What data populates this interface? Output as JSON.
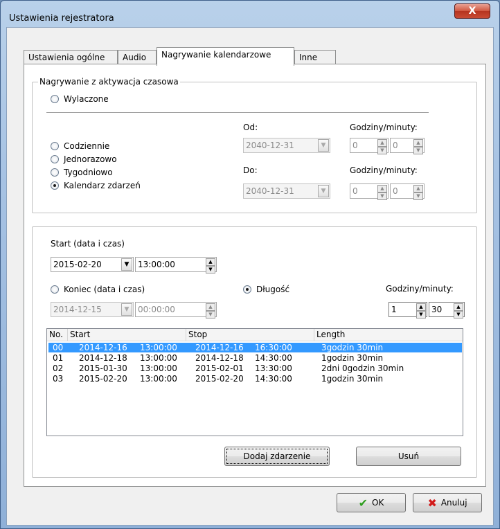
{
  "window": {
    "title": "Ustawienia rejestratora",
    "close_glyph": "X"
  },
  "tabs": [
    {
      "label": "Ustawienia ogólne"
    },
    {
      "label": "Audio"
    },
    {
      "label": "Nagrywanie kalendarzowe"
    },
    {
      "label": "Inne"
    }
  ],
  "timed_group": {
    "title": "Nagrywanie z aktywacja czasowa",
    "off_radio": "Wylaczone",
    "mode_radios": [
      "Codziennie",
      "Jednorazowo",
      "Tygodniowo",
      "Kalendarz zdarzeń"
    ],
    "selected_mode": "Kalendarz zdarzeń",
    "from_label": "Od:",
    "to_label": "Do:",
    "from_date": "2040-12-31",
    "to_date": "2040-12-31",
    "hours_minutes_label": "Godziny/minuty:",
    "from_hours": "0",
    "from_minutes": "0",
    "to_hours": "0",
    "to_minutes": "0"
  },
  "event_group": {
    "start_label": "Start (data i czas)",
    "start_date": "2015-02-20",
    "start_time": "13:00:00",
    "end_label": "Koniec (data i czas)",
    "end_date": "2014-12-15",
    "end_time": "00:00:00",
    "length_label": "Długość",
    "length_selected": true,
    "hours_minutes_label": "Godziny/minuty:",
    "length_hours": "1",
    "length_minutes": "30"
  },
  "events_table": {
    "columns": [
      "No.",
      "Start",
      "Stop",
      "Length"
    ],
    "rows": [
      {
        "no": "00",
        "start_date": "2014-12-16",
        "start_time": "13:00:00",
        "stop_date": "2014-12-16",
        "stop_time": "16:30:00",
        "length": "3godzin 30min",
        "selected": true
      },
      {
        "no": "01",
        "start_date": "2014-12-18",
        "start_time": "13:00:00",
        "stop_date": "2014-12-18",
        "stop_time": "14:30:00",
        "length": "1godzin 30min",
        "selected": false
      },
      {
        "no": "02",
        "start_date": "2015-01-30",
        "start_time": "13:00:00",
        "stop_date": "2015-02-01",
        "stop_time": "13:30:00",
        "length": "2dni 0godzin 30min",
        "selected": false
      },
      {
        "no": "03",
        "start_date": "2015-02-20",
        "start_time": "13:00:00",
        "stop_date": "2015-02-20",
        "stop_time": "14:30:00",
        "length": "1godzin 30min",
        "selected": false
      }
    ]
  },
  "buttons": {
    "add_event": "Dodaj zdarzenie",
    "remove": "Usuń",
    "ok": "OK",
    "cancel": "Anuluj"
  },
  "colors": {
    "selection": "#3399ff",
    "ok_check": "#2e9e1f",
    "cancel_x": "#d21b1b"
  }
}
